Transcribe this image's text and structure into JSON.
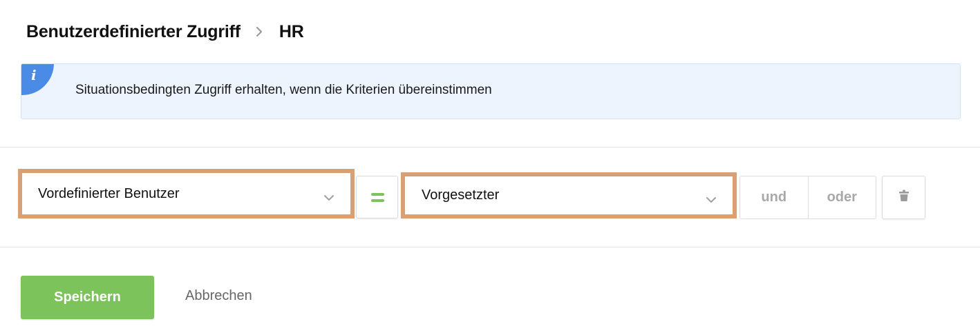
{
  "breadcrumb": {
    "parent": "Benutzerdefinierter Zugriff",
    "current": "HR"
  },
  "info": {
    "icon": "i",
    "message": "Situationsbedingten Zugriff erhalten, wenn die Kriterien übereinstimmen"
  },
  "criteria": {
    "field_value": "Vordefinierter Benutzer",
    "operator_icon": "equals-icon",
    "value_value": "Vorgesetzter",
    "logic_and": "und",
    "logic_or": "oder",
    "delete_icon": "trash-icon"
  },
  "actions": {
    "save_label": "Speichern",
    "cancel_label": "Abbrechen"
  },
  "colors": {
    "accent_green": "#7cc35c",
    "info_blue": "#4a8be5",
    "highlight": "#d9a073"
  }
}
